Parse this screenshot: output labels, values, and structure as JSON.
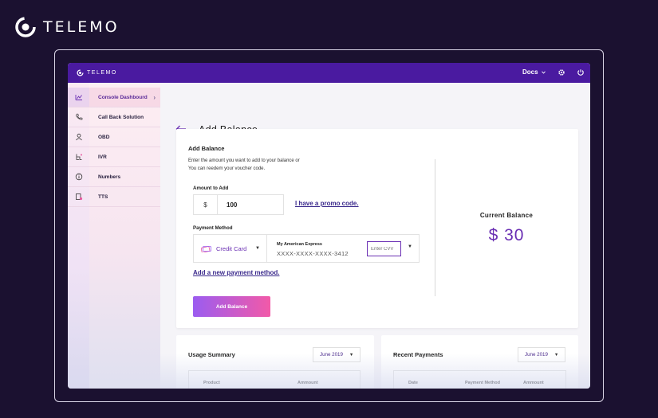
{
  "brand": {
    "name": "TELEMO"
  },
  "topbar": {
    "logo_text": "TELEMO",
    "docs_label": "Docs"
  },
  "sidebar": {
    "items": [
      {
        "label": "Console Dashbourd",
        "icon": "dashboard-icon"
      },
      {
        "label": "Call Back Solution",
        "icon": "phone-icon"
      },
      {
        "label": "OBD",
        "icon": "user-icon"
      },
      {
        "label": "IVR",
        "icon": "ivr-icon"
      },
      {
        "label": "Numbers",
        "icon": "info-icon"
      },
      {
        "label": "TTS",
        "icon": "tts-icon"
      }
    ]
  },
  "page": {
    "title": "Add Balance"
  },
  "add_balance": {
    "heading": "Add Balance",
    "desc_line1": "Enter the amount you want to add to your balance or",
    "desc_line2": "You can reedem your voucher code.",
    "amount_label": "Amount to Add",
    "currency": "$",
    "amount_value": "100",
    "promo_link": "I have a promo code.",
    "payment_label": "Payment Method",
    "payment_method": "Credit Card",
    "account_name": "My American Express",
    "account_number": "XXXX-XXXX-XXXX-3412",
    "cvv_placeholder": "Enter CVV",
    "add_method_link": "Add a new payment method.",
    "submit_label": "Add Balance"
  },
  "balance": {
    "label": "Current Balance",
    "value": "$ 30"
  },
  "usage_summary": {
    "title": "Usage Summary",
    "month": "June 2019",
    "columns": [
      "Product",
      "Ammount"
    ]
  },
  "recent_payments": {
    "title": "Recent Payments",
    "month": "June 2019",
    "columns": [
      "Date",
      "Payment Method",
      "Ammount"
    ]
  },
  "colors": {
    "primary": "#4a1aa0",
    "accent": "#6a2fb3",
    "gradient_start": "#9b5cf0",
    "gradient_end": "#f25aa8"
  }
}
